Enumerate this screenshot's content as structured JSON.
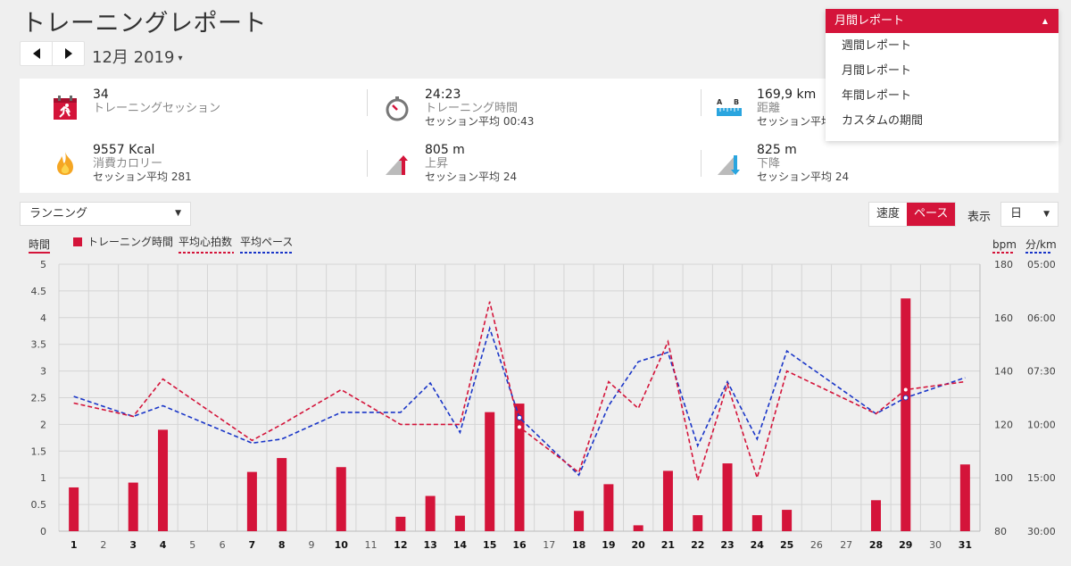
{
  "page": {
    "title": "トレーニングレポート"
  },
  "nav": {
    "period_label": "12月 2019",
    "period_caret": "▾"
  },
  "summary": {
    "sessions": {
      "value": "34",
      "label": "トレーニングセッション"
    },
    "duration": {
      "value": "24:23",
      "label": "トレーニング時間",
      "sub": "セッション平均 00:43"
    },
    "distance": {
      "value": "169,9 km",
      "label": "距離",
      "sub": "セッション平均 5"
    },
    "calories": {
      "value": "9557 Kcal",
      "label": "消費カロリー",
      "sub": "セッション平均 281"
    },
    "ascent": {
      "value": "805 m",
      "label": "上昇",
      "sub": "セッション平均 24"
    },
    "descent": {
      "value": "825 m",
      "label": "下降",
      "sub": "セッション平均 24"
    }
  },
  "report_dropdown": {
    "selected": "月間レポート",
    "options": [
      "週間レポート",
      "月間レポート",
      "年間レポート",
      "カスタムの期間"
    ]
  },
  "controls": {
    "sport": "ランニング",
    "speed_label": "速度",
    "pace_label": "ペース",
    "display_label": "表示",
    "display_value": "日"
  },
  "colors": {
    "accent": "#d4143a",
    "blue": "#1a36c8",
    "grid": "#d4d4d4"
  },
  "chart_data": {
    "type": "bar",
    "left_axis_label": "時間",
    "right_axis_label_1": "bpm",
    "right_axis_label_2": "分/km",
    "legend": [
      "トレーニング時間",
      "平均心拍数",
      "平均ペース"
    ],
    "left_ticks": [
      "0",
      "0.5",
      "1",
      "1.5",
      "2",
      "2.5",
      "3",
      "3.5",
      "4",
      "4.5",
      "5"
    ],
    "bpm_ticks": [
      "80",
      "100",
      "120",
      "140",
      "160",
      "180"
    ],
    "pace_ticks": [
      "30:00",
      "15:00",
      "10:00",
      "07:30",
      "06:00",
      "05:00"
    ],
    "ylim": [
      0,
      5
    ],
    "bpm_lim": [
      80,
      180
    ],
    "days": [
      "1",
      "2",
      "3",
      "4",
      "5",
      "6",
      "7",
      "8",
      "9",
      "10",
      "11",
      "12",
      "13",
      "14",
      "15",
      "16",
      "17",
      "18",
      "19",
      "20",
      "21",
      "22",
      "23",
      "24",
      "25",
      "26",
      "27",
      "28",
      "29",
      "30",
      "31"
    ],
    "bold_days": [
      "1",
      "3",
      "4",
      "7",
      "8",
      "10",
      "12",
      "13",
      "14",
      "15",
      "16",
      "18",
      "19",
      "20",
      "21",
      "22",
      "23",
      "24",
      "25",
      "28",
      "29",
      "31"
    ],
    "session_days": [
      1,
      3,
      4,
      7,
      8,
      10,
      12,
      13,
      14,
      15,
      16,
      18,
      19,
      20,
      21,
      22,
      23,
      24,
      25,
      28,
      29,
      31
    ],
    "hours": [
      0.82,
      0.91,
      1.9,
      1.11,
      1.37,
      1.2,
      0.27,
      0.66,
      0.29,
      2.23,
      2.39,
      0.38,
      0.88,
      0.11,
      1.13,
      0.3,
      1.27,
      0.3,
      0.4,
      0.58,
      4.36,
      1.25
    ],
    "heart_rate": [
      128,
      123,
      137,
      114,
      120,
      133,
      120,
      120,
      120,
      166,
      119,
      102,
      136,
      126,
      151,
      99,
      135,
      100,
      140,
      124,
      133,
      136
    ],
    "pace_level": [
      130.5,
      123.0,
      127.0,
      113.0,
      114.5,
      124.5,
      124.5,
      135.5,
      117.0,
      156.0,
      122.5,
      101.0,
      127.0,
      143.5,
      147.0,
      112.0,
      136.0,
      114.5,
      147.5,
      124.0,
      130.0,
      137.5
    ]
  }
}
